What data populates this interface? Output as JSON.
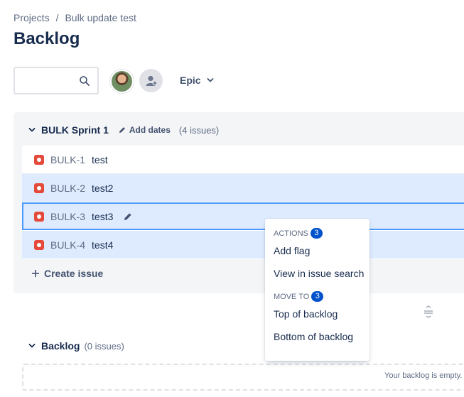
{
  "breadcrumb": {
    "project": "Projects",
    "separator": "/",
    "board": "Bulk update test"
  },
  "page_title": "Backlog",
  "toolbar": {
    "epic_label": "Epic"
  },
  "sprint": {
    "name": "BULK Sprint 1",
    "add_dates": "Add dates",
    "issue_count": "(4 issues)",
    "issues": [
      {
        "key": "BULK-1",
        "summary": "test",
        "selected": false
      },
      {
        "key": "BULK-2",
        "summary": "test2",
        "selected": true
      },
      {
        "key": "BULK-3",
        "summary": "test3",
        "selected": true
      },
      {
        "key": "BULK-4",
        "summary": "test4",
        "selected": true
      }
    ],
    "create_issue": "Create issue"
  },
  "backlog": {
    "title": "Backlog",
    "issue_count": "(0 issues)",
    "empty_text": "Your backlog is empty."
  },
  "context_menu": {
    "actions_heading": "ACTIONS",
    "actions_count": "3",
    "add_flag": "Add flag",
    "view_in_search": "View in issue search",
    "move_to_heading": "MOVE TO",
    "move_to_count": "3",
    "top_of_backlog": "Top of backlog",
    "bottom_of_backlog": "Bottom of backlog"
  },
  "colors": {
    "accent": "#0052cc",
    "selection": "#deebff",
    "focus_ring": "#4c9aff",
    "bug": "#e5493a"
  }
}
